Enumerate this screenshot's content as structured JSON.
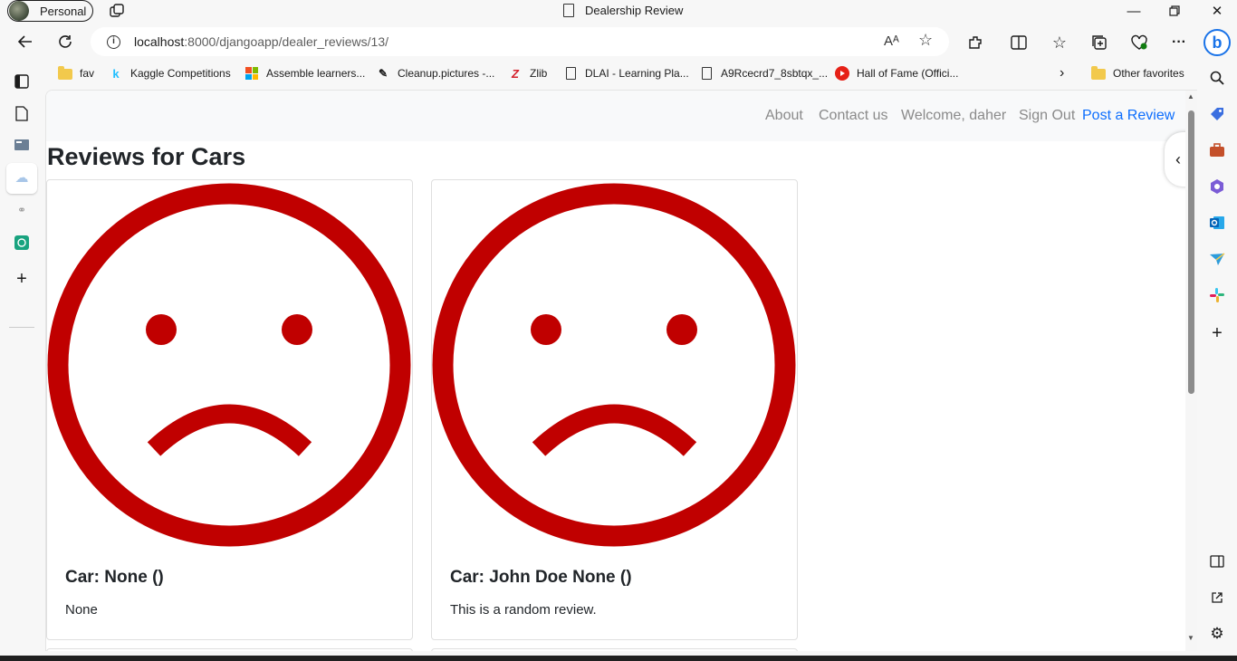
{
  "browser": {
    "profile_label": "Personal",
    "tab_title": "Dealership Review",
    "url_host": "localhost",
    "url_path": ":8000/djangoapp/dealer_reviews/13/",
    "read_aloud_glyph": "Aᴬ"
  },
  "favorites": [
    {
      "label": "fav",
      "icon": "folder-icon"
    },
    {
      "label": "Kaggle Competitions",
      "icon": "kaggle-icon"
    },
    {
      "label": "Assemble learners...",
      "icon": "microsoft-icon"
    },
    {
      "label": "Cleanup.pictures -...",
      "icon": "cleanup-icon"
    },
    {
      "label": "Zlib",
      "icon": "zlib-icon"
    },
    {
      "label": "DLAI - Learning Pla...",
      "icon": "page-icon"
    },
    {
      "label": "A9Rcecrd7_8sbtqx_...",
      "icon": "page-icon"
    },
    {
      "label": "Hall of Fame (Offici...",
      "icon": "youtube-icon"
    }
  ],
  "other_favorites": "Other favorites",
  "site": {
    "nav": {
      "about": "About",
      "contact": "Contact us",
      "welcome": "Welcome, daher",
      "signout": "Sign Out",
      "post_review": "Post a Review"
    },
    "page_title": "Reviews for Cars",
    "reviews": [
      {
        "car": "Car: None ()",
        "review": "None",
        "sentiment_icon": "sad-face-icon"
      },
      {
        "car": "Car: John Doe None ()",
        "review": "This is a random review.",
        "sentiment_icon": "sad-face-icon"
      }
    ]
  },
  "colors": {
    "sentiment_negative": "#c00000",
    "link_primary": "#0d6efd",
    "nav_muted": "#8a8a8a"
  }
}
